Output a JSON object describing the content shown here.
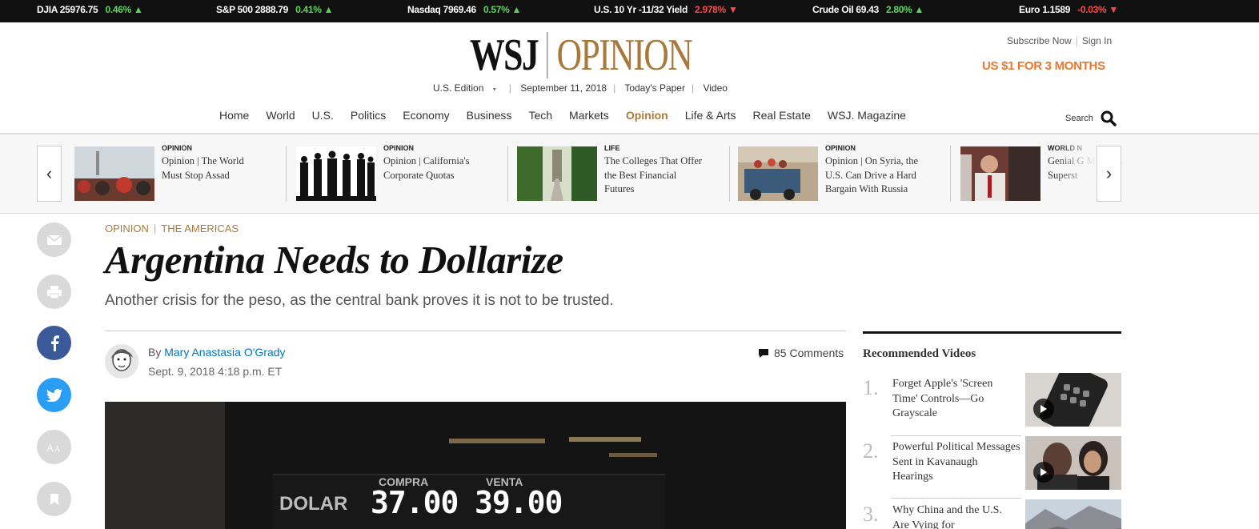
{
  "ticker": [
    {
      "name": "DJIA",
      "value": "25976.75",
      "change": "0.46%",
      "dir": "up"
    },
    {
      "name": "S&P 500",
      "value": "2888.79",
      "change": "0.41%",
      "dir": "up"
    },
    {
      "name": "Nasdaq",
      "value": "7969.46",
      "change": "0.57%",
      "dir": "up"
    },
    {
      "name": "U.S. 10 Yr",
      "value": "-11/32 Yield",
      "change": "2.978%",
      "dir": "down"
    },
    {
      "name": "Crude Oil",
      "value": "69.43",
      "change": "2.80%",
      "dir": "up"
    },
    {
      "name": "Euro",
      "value": "1.1589",
      "change": "-0.03%",
      "dir": "down"
    }
  ],
  "header": {
    "logo_wsj": "WSJ",
    "logo_section": "OPINION",
    "edition": "U.S. Edition",
    "date": "September 11, 2018",
    "todays_paper": "Today's Paper",
    "video": "Video",
    "subscribe": "Subscribe Now",
    "signin": "Sign In",
    "promo": "US $1 FOR 3 MONTHS",
    "search_label": "Search"
  },
  "nav": [
    "Home",
    "World",
    "U.S.",
    "Politics",
    "Economy",
    "Business",
    "Tech",
    "Markets",
    "Opinion",
    "Life & Arts",
    "Real Estate",
    "WSJ. Magazine"
  ],
  "nav_active": "Opinion",
  "carousel": [
    {
      "kicker": "OPINION",
      "headline": "Opinion | The World Must Stop Assad"
    },
    {
      "kicker": "OPINION",
      "headline": "Opinion | California's Corporate Quotas"
    },
    {
      "kicker": "LIFE",
      "headline": "The Colleges That Offer the Best Financial Futures"
    },
    {
      "kicker": "OPINION",
      "headline": "Opinion | On Syria, the U.S. Can Drive a Hard Bargain With Russia"
    },
    {
      "kicker": "WORLD N",
      "headline": "Genial G Made Hi Superst"
    }
  ],
  "article": {
    "section": "OPINION",
    "subsection": "THE AMERICAS",
    "headline": "Argentina Needs to Dollarize",
    "dek": "Another crisis for the peso, as the central bank proves it is not to be trusted.",
    "by": "By",
    "author": "Mary Anastasia O'Grady",
    "date": "Sept. 9, 2018 4:18 p.m. ET",
    "comments": "85 Comments"
  },
  "hero": {
    "currency": "DOLAR",
    "buy_label": "COMPRA",
    "sell_label": "VENTA",
    "buy": "37.00",
    "sell": "39.00"
  },
  "sidebar": {
    "title": "Recommended Videos",
    "videos": [
      {
        "num": "1.",
        "title": "Forget Apple's 'Screen Time' Controls—Go Grayscale"
      },
      {
        "num": "2.",
        "title": "Powerful Political Messages Sent in Kavanaugh Hearings"
      },
      {
        "num": "3.",
        "title": "Why China and the U.S. Are Vying for"
      }
    ]
  },
  "colors": {
    "accent": "#a8793a",
    "promo": "#e8782f",
    "link": "#0274b6",
    "up": "#5cd65c",
    "down": "#ff4a4a"
  }
}
